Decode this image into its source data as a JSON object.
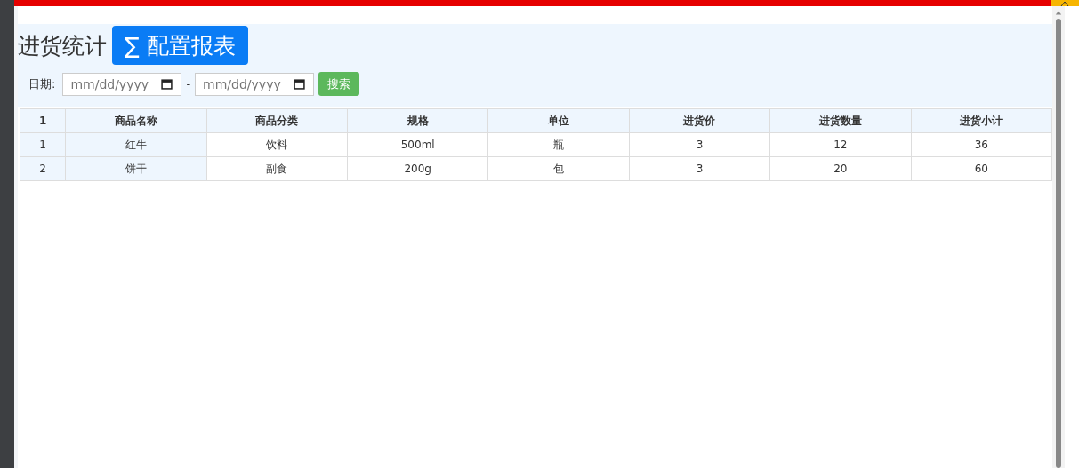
{
  "title": "进货统计",
  "config_button": {
    "icon": "∑",
    "label": "配置报表"
  },
  "filter": {
    "label": "日期:",
    "from": {
      "placeholder": "mm/dd/yyyy"
    },
    "separator": "-",
    "to": {
      "placeholder": "mm/dd/yyyy"
    },
    "search_button": "搜索"
  },
  "table": {
    "columns": [
      "1",
      "商品名称",
      "商品分类",
      "规格",
      "单位",
      "进货价",
      "进货数量",
      "进货小计"
    ],
    "rows": [
      [
        "1",
        "红牛",
        "饮料",
        "500ml",
        "瓶",
        "3",
        "12",
        "36"
      ],
      [
        "2",
        "饼干",
        "副食",
        "200g",
        "包",
        "3",
        "20",
        "60"
      ]
    ]
  }
}
